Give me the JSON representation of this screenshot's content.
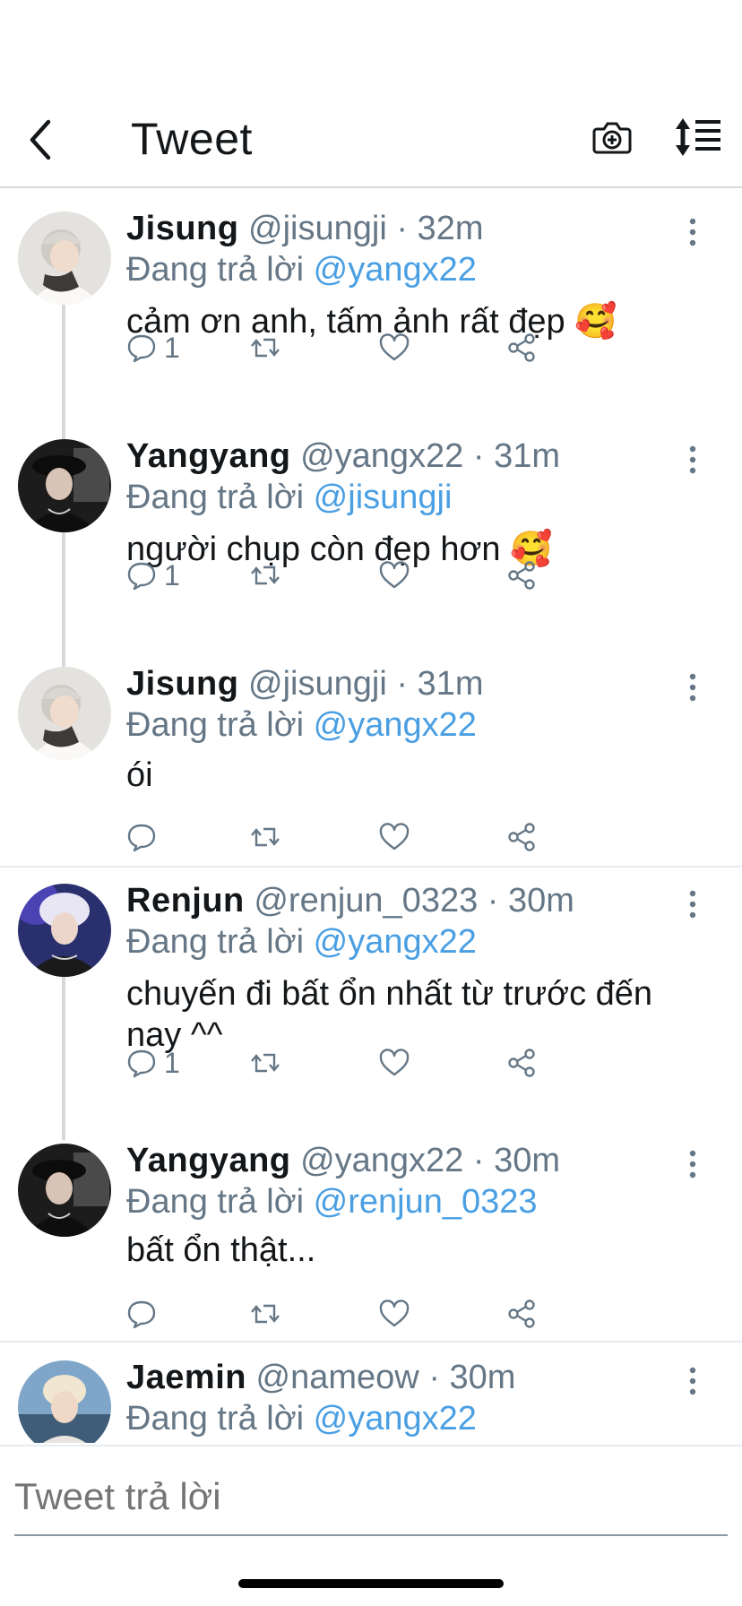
{
  "header": {
    "title": "Tweet",
    "icons": [
      "back-icon",
      "camera-icon",
      "sort-icon"
    ]
  },
  "reply_prefix": "Đang trả lời",
  "tweets": [
    {
      "name": "Jisung",
      "handle": "@jisungji",
      "time": "· 32m",
      "reply_to": "@yangx22",
      "text": "cảm ơn anh, tấm ảnh rất đẹp 🥰",
      "reply_count": "1"
    },
    {
      "name": "Yangyang",
      "handle": "@yangx22",
      "time": "· 31m",
      "reply_to": "@jisungji",
      "text": "người chụp còn đẹp hơn 🥰",
      "reply_count": "1"
    },
    {
      "name": "Jisung",
      "handle": "@jisungji",
      "time": "· 31m",
      "reply_to": "@yangx22",
      "text": "ói",
      "reply_count": ""
    },
    {
      "name": "Renjun",
      "handle": "@renjun_0323",
      "time": "· 30m",
      "reply_to": "@yangx22",
      "text": "chuyến đi bất ổn nhất từ trước đến nay ^^",
      "reply_count": "1"
    },
    {
      "name": "Yangyang",
      "handle": "@yangx22",
      "time": "· 30m",
      "reply_to": "@renjun_0323",
      "text": "bất ổn thật...",
      "reply_count": ""
    },
    {
      "name": "Jaemin",
      "handle": "@nameow",
      "time": "· 30m",
      "reply_to": "@yangx22",
      "text": "",
      "reply_count": ""
    }
  ],
  "composer": {
    "placeholder": "Tweet trả lời"
  },
  "colors": {
    "mention": "#4a9fe3",
    "secondary_text": "#657786",
    "divider": "#e6ecf0"
  }
}
